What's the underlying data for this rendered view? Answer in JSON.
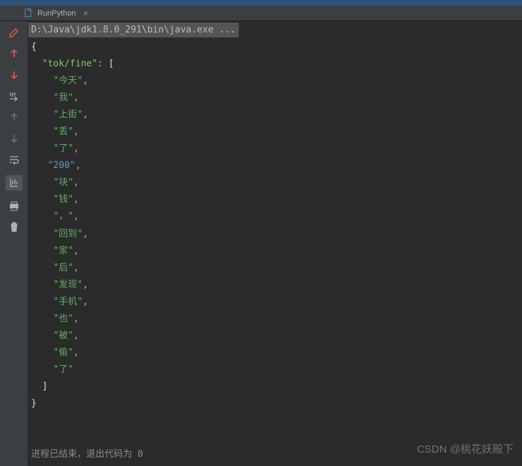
{
  "tab": {
    "name": "RunPython"
  },
  "command_line": "D:\\Java\\jdk1.8.0_291\\bin\\java.exe ...",
  "json": {
    "key": "\"tok/fine\"",
    "open_brace": "{",
    "close_brace": "}",
    "open_bracket": "[",
    "close_bracket": "]",
    "colon": ": ",
    "items": [
      "\"今天\"",
      "\"我\"",
      "\"上街\"",
      "\"丢\"",
      "\"了\"",
      "\"200\"",
      "\"块\"",
      "\"钱\"",
      "\"，\"",
      "\"回到\"",
      "\"家\"",
      "\"后\"",
      "\"发现\"",
      "\"手机\"",
      "\"也\"",
      "\"被\"",
      "\"偷\"",
      "\"了\""
    ],
    "comma": ","
  },
  "exit_message": "进程已结束，退出代码为 ",
  "exit_code": "0",
  "watermark": "CSDN @桃花妖殿下",
  "gutter_icons": [
    "edit-icon",
    "up-red-icon",
    "down-red-icon",
    "step-into-icon",
    "up-gray-icon",
    "down-gray-icon",
    "wrap-icon",
    "scroll-end-icon",
    "print-icon",
    "trash-icon"
  ]
}
